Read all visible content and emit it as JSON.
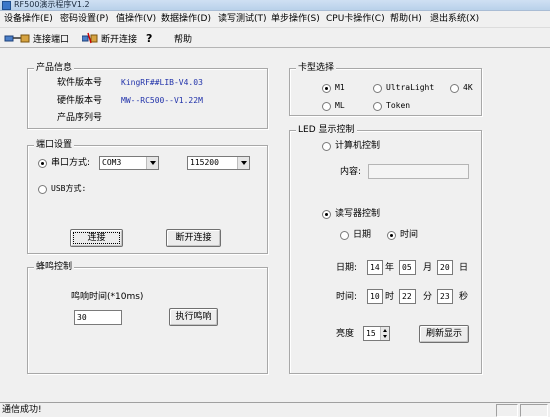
{
  "window": {
    "title": "RF500演示程序V1.2"
  },
  "menu": [
    "设备操作(E)",
    "密码设置(P)",
    "值操作(V)",
    "数据操作(D)",
    "读写测试(T)",
    "单步操作(S)",
    "CPU卡操作(C)",
    "帮助(H)",
    "退出系统(X)"
  ],
  "toolbar": {
    "connect": "连接端口",
    "disconnect": "断开连接",
    "help": "帮助"
  },
  "product_info": {
    "title": "产品信息",
    "software_label": "软件版本号",
    "software_value": "KingRF##LIB-V4.03",
    "hardware_label": "硬件版本号",
    "hardware_value": "MW--RC500--V1.22M",
    "serial_label": "产品序列号"
  },
  "port": {
    "title": "端口设置",
    "serial_label": "串口方式:",
    "com_value": "COM3",
    "baud_value": "115200",
    "usb_label": "USB方式:",
    "connect_button": "连接",
    "disconnect_button": "断开连接"
  },
  "beep": {
    "title": "蜂鸣控制",
    "time_label": "鸣响时间(*10ms)",
    "time_value": "30",
    "run_button": "执行鸣响"
  },
  "card_type": {
    "title": "卡型选择",
    "options": [
      "M1",
      "UltraLight",
      "4K",
      "ML",
      "Token"
    ]
  },
  "led": {
    "title": "LED 显示控制",
    "pc_control": "计算机控制",
    "content_label": "内容:",
    "reader_control": "读写器控制",
    "date_option": "日期",
    "time_option": "时间",
    "date_label": "日期:",
    "year_value": "14",
    "year_unit": "年",
    "month_value": "05",
    "month_unit": "月",
    "day_value": "20",
    "day_unit": "日",
    "time_label": "时间:",
    "hour_value": "10",
    "hour_unit": "时",
    "minute_value": "22",
    "minute_unit": "分",
    "second_value": "23",
    "second_unit": "秒",
    "brightness_label": "亮度",
    "brightness_value": "15",
    "refresh_button": "刷新显示"
  },
  "status": {
    "message": "通信成功!"
  }
}
